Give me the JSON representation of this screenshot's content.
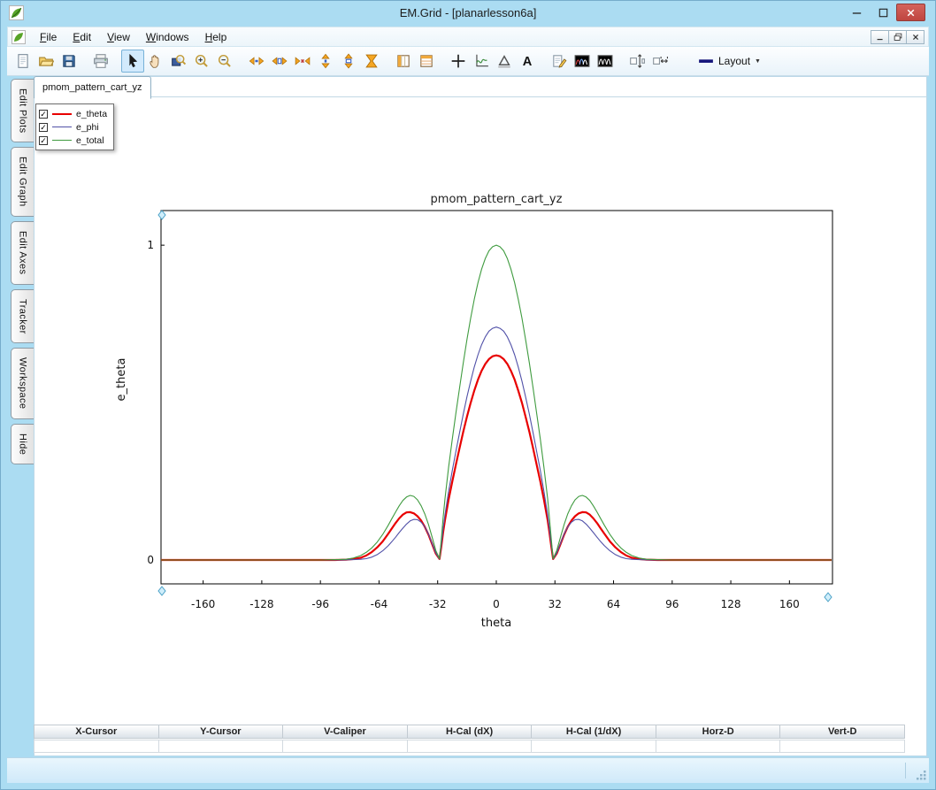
{
  "window": {
    "title": "EM.Grid - [planarlesson6a]"
  },
  "menubar": {
    "items": [
      "File",
      "Edit",
      "View",
      "Windows",
      "Help"
    ]
  },
  "toolbar": {
    "buttons": [
      "new",
      "open",
      "save",
      "|",
      "print",
      "|",
      "select",
      "pan",
      "zoom-region",
      "zoom-in",
      "zoom-out",
      "|",
      "h-expand",
      "h-range",
      "h-compress",
      "v-expand",
      "v-range",
      "v-compress",
      "|",
      "table-columns",
      "table-rows",
      "|",
      "crosshair",
      "axes-curve",
      "delta-marker",
      "text-label",
      "|",
      "annotate",
      "waves-color",
      "waves-mono",
      "|",
      "v-autofit",
      "h-autofit"
    ],
    "active": "select",
    "layout_label": "Layout"
  },
  "sidebar": {
    "tabs": [
      "Edit Plots",
      "Edit Graph",
      "Edit Axes",
      "Tracker",
      "Workspace",
      "Hide"
    ]
  },
  "document": {
    "tab": "pmom_pattern_cart_yz"
  },
  "legend": {
    "items": [
      {
        "label": "e_theta",
        "color": "#e80000",
        "checked": true,
        "width": 2
      },
      {
        "label": "e_phi",
        "color": "#5151a8",
        "checked": true,
        "width": 1
      },
      {
        "label": "e_total",
        "color": "#3f9b3f",
        "checked": true,
        "width": 1
      }
    ]
  },
  "chart_data": {
    "type": "line",
    "title": "pmom_pattern_cart_yz",
    "xlabel": "theta",
    "ylabel": "e_theta",
    "xlim": [
      -183,
      183.5
    ],
    "ylim": [
      -0.076,
      1.11
    ],
    "xticks": [
      -160,
      -128,
      -96,
      -64,
      -32,
      0,
      32,
      64,
      96,
      128,
      160
    ],
    "yticks": [
      0,
      1
    ],
    "grid": false,
    "legend_position": "top-left",
    "symmetric_about_x0": true,
    "series": [
      {
        "name": "e_theta",
        "color": "#e80000",
        "width": 2.2,
        "points": [
          [
            0,
            0.65
          ],
          [
            2,
            0.647
          ],
          [
            4,
            0.638
          ],
          [
            6,
            0.623
          ],
          [
            8,
            0.601
          ],
          [
            10,
            0.573
          ],
          [
            12,
            0.538
          ],
          [
            14,
            0.499
          ],
          [
            16,
            0.455
          ],
          [
            18,
            0.408
          ],
          [
            20,
            0.357
          ],
          [
            22,
            0.304
          ],
          [
            24,
            0.25
          ],
          [
            26,
            0.192
          ],
          [
            28,
            0.127
          ],
          [
            29,
            0.088
          ],
          [
            30,
            0.044
          ],
          [
            31,
            0.003
          ],
          [
            33,
            0.02
          ],
          [
            35,
            0.05
          ],
          [
            37,
            0.08
          ],
          [
            39,
            0.105
          ],
          [
            41,
            0.125
          ],
          [
            43,
            0.139
          ],
          [
            45,
            0.148
          ],
          [
            47,
            0.152
          ],
          [
            49,
            0.151
          ],
          [
            51,
            0.144
          ],
          [
            53,
            0.132
          ],
          [
            55,
            0.117
          ],
          [
            57,
            0.1
          ],
          [
            59,
            0.083
          ],
          [
            62,
            0.059
          ],
          [
            65,
            0.04
          ],
          [
            68,
            0.025
          ],
          [
            71,
            0.014
          ],
          [
            74,
            0.007
          ],
          [
            78,
            0.003
          ],
          [
            82,
            0.001
          ],
          [
            88,
            0
          ],
          [
            100,
            0
          ],
          [
            120,
            0
          ],
          [
            150,
            0
          ],
          [
            183,
            0
          ]
        ]
      },
      {
        "name": "e_phi",
        "color": "#5151a8",
        "width": 1.1,
        "points": [
          [
            0,
            0.74
          ],
          [
            2,
            0.736
          ],
          [
            4,
            0.727
          ],
          [
            6,
            0.709
          ],
          [
            8,
            0.684
          ],
          [
            10,
            0.652
          ],
          [
            12,
            0.613
          ],
          [
            14,
            0.568
          ],
          [
            16,
            0.518
          ],
          [
            18,
            0.464
          ],
          [
            20,
            0.406
          ],
          [
            22,
            0.346
          ],
          [
            24,
            0.285
          ],
          [
            26,
            0.218
          ],
          [
            28,
            0.144
          ],
          [
            29,
            0.1
          ],
          [
            30,
            0.05
          ],
          [
            31,
            0.003
          ],
          [
            33,
            0.022
          ],
          [
            35,
            0.052
          ],
          [
            37,
            0.082
          ],
          [
            39,
            0.105
          ],
          [
            41,
            0.12
          ],
          [
            43,
            0.128
          ],
          [
            45,
            0.129
          ],
          [
            47,
            0.124
          ],
          [
            49,
            0.114
          ],
          [
            51,
            0.101
          ],
          [
            53,
            0.087
          ],
          [
            55,
            0.072
          ],
          [
            57,
            0.058
          ],
          [
            59,
            0.045
          ],
          [
            62,
            0.029
          ],
          [
            65,
            0.017
          ],
          [
            68,
            0.009
          ],
          [
            71,
            0.004
          ],
          [
            74,
            0.002
          ],
          [
            78,
            0.001
          ],
          [
            84,
            0
          ],
          [
            100,
            0
          ],
          [
            120,
            0
          ],
          [
            150,
            0
          ],
          [
            183,
            0
          ]
        ]
      },
      {
        "name": "e_total",
        "color": "#3f9b3f",
        "width": 1.1,
        "points": [
          [
            0,
            1.0
          ],
          [
            2,
            0.995
          ],
          [
            4,
            0.982
          ],
          [
            6,
            0.958
          ],
          [
            8,
            0.924
          ],
          [
            10,
            0.881
          ],
          [
            12,
            0.828
          ],
          [
            14,
            0.768
          ],
          [
            16,
            0.7
          ],
          [
            18,
            0.627
          ],
          [
            20,
            0.549
          ],
          [
            22,
            0.468
          ],
          [
            24,
            0.385
          ],
          [
            26,
            0.295
          ],
          [
            28,
            0.195
          ],
          [
            29,
            0.135
          ],
          [
            30,
            0.068
          ],
          [
            31,
            0.004
          ],
          [
            33,
            0.03
          ],
          [
            35,
            0.072
          ],
          [
            37,
            0.112
          ],
          [
            39,
            0.146
          ],
          [
            41,
            0.172
          ],
          [
            43,
            0.191
          ],
          [
            45,
            0.202
          ],
          [
            47,
            0.205
          ],
          [
            49,
            0.2
          ],
          [
            51,
            0.189
          ],
          [
            53,
            0.172
          ],
          [
            55,
            0.152
          ],
          [
            57,
            0.131
          ],
          [
            59,
            0.11
          ],
          [
            62,
            0.081
          ],
          [
            65,
            0.057
          ],
          [
            68,
            0.038
          ],
          [
            71,
            0.024
          ],
          [
            74,
            0.014
          ],
          [
            78,
            0.006
          ],
          [
            82,
            0.002
          ],
          [
            88,
            0.001
          ],
          [
            96,
            0
          ],
          [
            120,
            0
          ],
          [
            150,
            0
          ],
          [
            183,
            0
          ]
        ]
      }
    ]
  },
  "readout_table": {
    "headers": [
      "X-Cursor",
      "Y-Cursor",
      "V-Caliper",
      "H-Cal (dX)",
      "H-Cal (1/dX)",
      "Horz-D",
      "Vert-D"
    ],
    "values": [
      "",
      "",
      "",
      "",
      "",
      "",
      ""
    ]
  }
}
